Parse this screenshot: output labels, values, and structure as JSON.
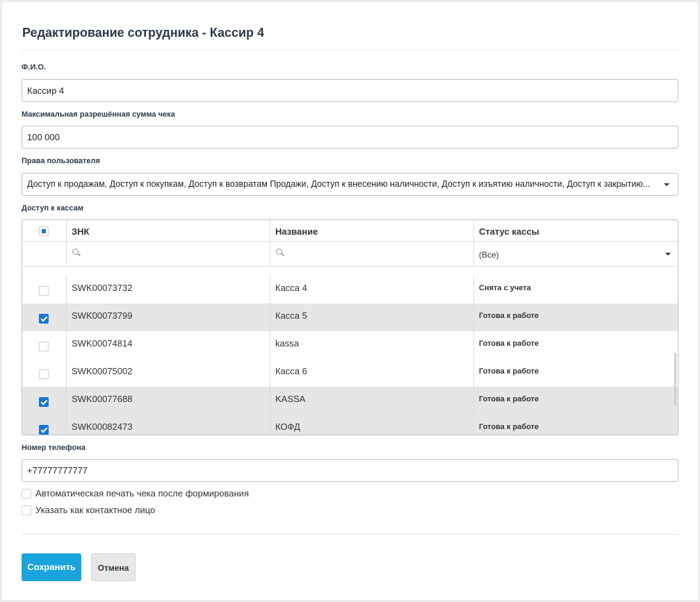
{
  "dialog": {
    "title": "Редактирование сотрудника - Кассир 4"
  },
  "fio": {
    "label": "Ф.И.О.",
    "value": "Кассир 4"
  },
  "max_sum": {
    "label": "Максимальная разрешённая сумма чека",
    "value": "100 000"
  },
  "rights": {
    "label": "Права пользователя",
    "value": "Доступ к продажам, Доступ к покупкам, Доступ к возвратам Продажи, Доступ к внесению наличности, Доступ к изъятию наличности, Доступ к закрытию..."
  },
  "access": {
    "label": "Доступ к кассам",
    "columns": {
      "znk": "ЗНК",
      "name": "Название",
      "status": "Статус кассы"
    },
    "status_filter": "(Все)",
    "rows": [
      {
        "znk": "SWK00073732",
        "name": "Касса 4",
        "status": "Снята с учета",
        "checked": false
      },
      {
        "znk": "SWK00073799",
        "name": "Касса 5",
        "status": "Готова к работе",
        "checked": true
      },
      {
        "znk": "SWK00074814",
        "name": "kassa",
        "status": "Готова к работе",
        "checked": false
      },
      {
        "znk": "SWK00075002",
        "name": "Касса 6",
        "status": "Готова к работе",
        "checked": false
      },
      {
        "znk": "SWK00077688",
        "name": "KASSA",
        "status": "Готова к работе",
        "checked": true
      },
      {
        "znk": "SWK00082473",
        "name": "КОФД",
        "status": "Готова к работе",
        "checked": true
      }
    ]
  },
  "phone": {
    "label": "Номер телефона",
    "value": "+77777777777"
  },
  "options": {
    "auto_print": "Автоматическая печать чека после формирования",
    "contact_person": "Указать как контактное лицо"
  },
  "buttons": {
    "save": "Сохранить",
    "cancel": "Отмена"
  },
  "colors": {
    "primary": "#1aa3dd",
    "checkbox": "#1976d2"
  }
}
